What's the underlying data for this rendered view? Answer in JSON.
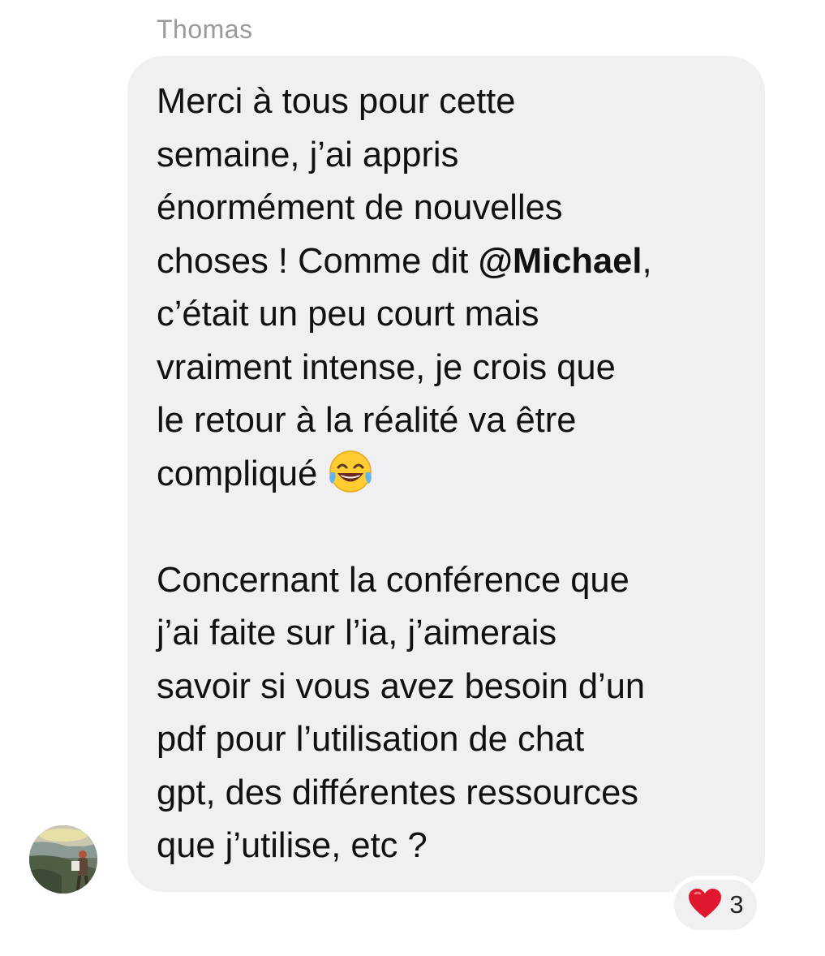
{
  "sender": {
    "name": "Thomas"
  },
  "message": {
    "line1": "Merci à tous pour cette",
    "line2": "semaine, j’ai appris",
    "line3": "énormément de nouvelles",
    "line4_before": "choses ! Comme dit ",
    "mention": "@Michael",
    "line4_after": ",",
    "line5": "c’était un peu court mais",
    "line6": "vraiment intense, je crois que",
    "line7": "le retour à la réalité va être",
    "line8": "compliqué",
    "emoji_icon": "face-with-tears-of-joy-icon",
    "para2_line1": "Concernant la conférence que",
    "para2_line2": "j’ai faite sur l’ia, j’aimerais",
    "para2_line3": "savoir si vous avez besoin d’un",
    "para2_line4": "pdf pour l’utilisation de chat",
    "para2_line5": "gpt, des différentes ressources",
    "para2_line6": "que j’utilise, etc ?"
  },
  "reaction": {
    "icon": "red-heart-icon",
    "count": "3"
  },
  "colors": {
    "bubble": "#f0f0f2",
    "sender_name": "#9a9a9f",
    "heart": "#e0182d"
  }
}
